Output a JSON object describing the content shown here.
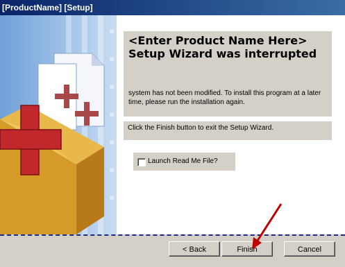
{
  "window": {
    "title": "[ProductName] [Setup]"
  },
  "main": {
    "heading": "<Enter Product Name Here> Setup Wizard was interrupted",
    "description": "system has not been modified.  To install this program at a later time, please run the installation again.",
    "instruction": "Click the Finish button to exit the Setup Wizard.",
    "launch_readme_label": "Launch Read Me File?",
    "launch_readme_checked": false
  },
  "buttons": {
    "back": "< Back",
    "finish": "Finish",
    "cancel": "Cancel"
  },
  "colors": {
    "titlebar": "#0a246a",
    "arrow": "#c00000",
    "divider": "#1a2a8a"
  }
}
